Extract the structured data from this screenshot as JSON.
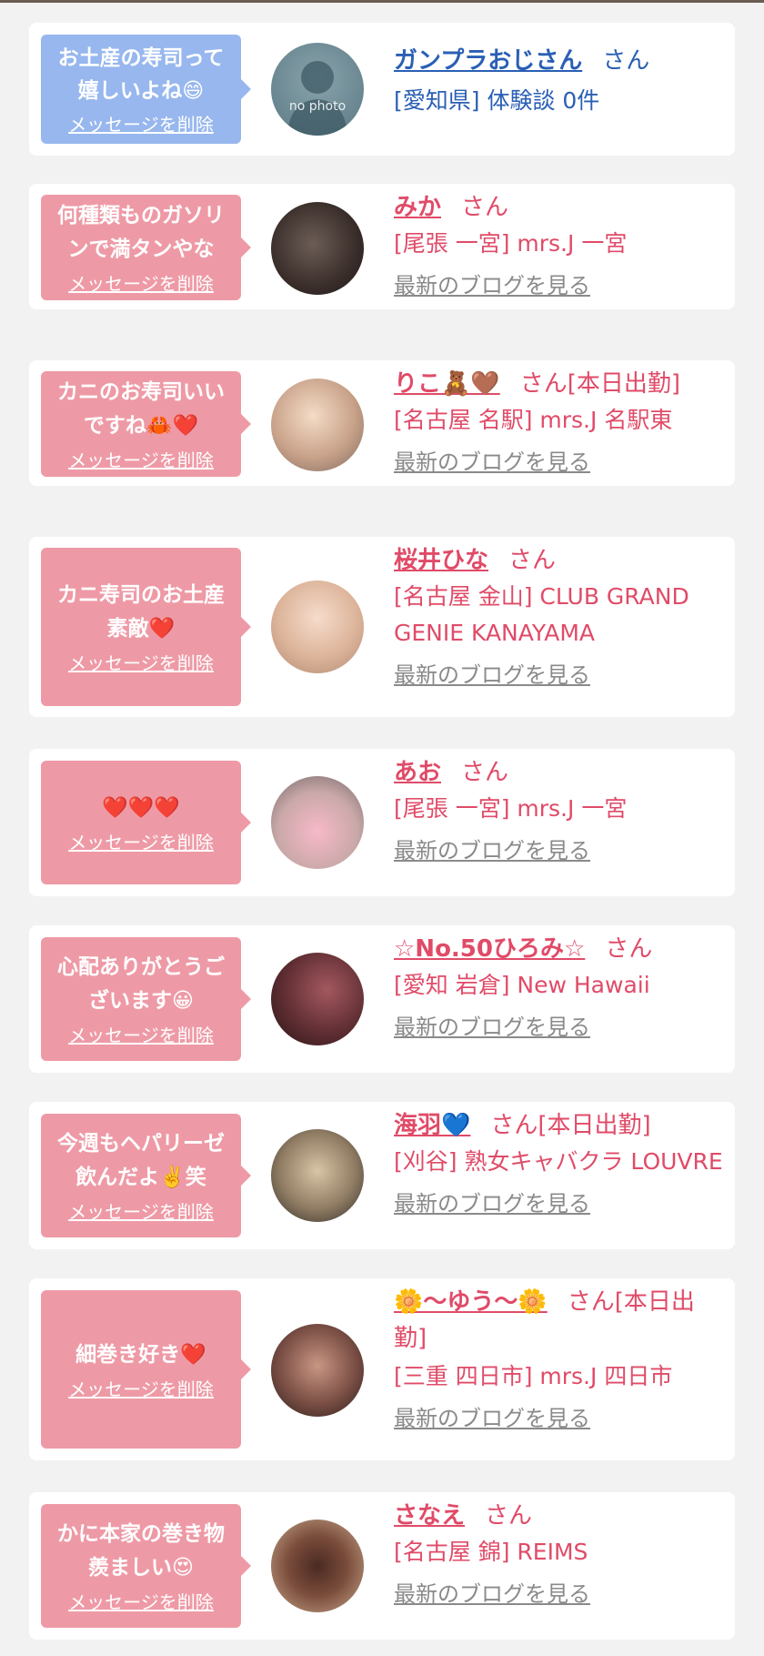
{
  "cards": [
    {
      "message": "お土産の寿司って嬉しいよね😄",
      "delete_label": "メッセージを削除",
      "name": "ガンプラおじさん",
      "suffix": "さん",
      "location": "[愛知県] 体験談 0件",
      "blog_link": "",
      "avatar_text": "no photo",
      "theme": "blue"
    },
    {
      "message": "何種類ものガソリンで満タンやな",
      "delete_label": "メッセージを削除",
      "name": "みか",
      "suffix": "さん",
      "location": "[尾張 一宮] mrs.J 一宮",
      "blog_link": "最新のブログを見る"
    },
    {
      "message": "カニのお寿司いいですね🦀❤️",
      "delete_label": "メッセージを削除",
      "name": "りこ🧸🤎",
      "suffix": "さん[本日出勤]",
      "location": "[名古屋 名駅] mrs.J 名駅東",
      "blog_link": "最新のブログを見る"
    },
    {
      "message": "カニ寿司のお土産素敵❤️",
      "delete_label": "メッセージを削除",
      "name": "桜井ひな",
      "suffix": "さん",
      "location": "[名古屋 金山] CLUB GRAND GENIE KANAYAMA",
      "blog_link": "最新のブログを見る"
    },
    {
      "message": "❤️❤️❤️",
      "delete_label": "メッセージを削除",
      "name": "あお",
      "suffix": "さん",
      "location": "[尾張 一宮] mrs.J 一宮",
      "blog_link": "最新のブログを見る"
    },
    {
      "message": "心配ありがとうございます😀",
      "delete_label": "メッセージを削除",
      "name": "☆No.50ひろみ☆",
      "suffix": "さん",
      "location": "[愛知 岩倉] New Hawaii",
      "blog_link": "最新のブログを見る"
    },
    {
      "message": "今週もヘパリーゼ飲んだよ✌️笑",
      "delete_label": "メッセージを削除",
      "name": "海羽💙",
      "suffix": "さん[本日出勤]",
      "location": "[刈谷] 熟女キャバクラ LOUVRE",
      "blog_link": "最新のブログを見る"
    },
    {
      "message": "細巻き好き❤️",
      "delete_label": "メッセージを削除",
      "name": "🌼〜ゆう〜🌼",
      "suffix": "さん[本日出勤]",
      "location": "[三重 四日市] mrs.J 四日市",
      "blog_link": "最新のブログを見る"
    },
    {
      "message": "かに本家の巻き物羨ましい😍",
      "delete_label": "メッセージを削除",
      "name": "さなえ",
      "suffix": "さん",
      "location": "[名古屋 錦] REIMS",
      "blog_link": "最新のブログを見る"
    }
  ],
  "colors": {
    "pink_bubble": "#ee9aa6",
    "blue_bubble": "#97b7ee",
    "name_pink": "#e04b68",
    "name_blue": "#2a5fb4",
    "blog_gray": "#8a8a8a"
  }
}
